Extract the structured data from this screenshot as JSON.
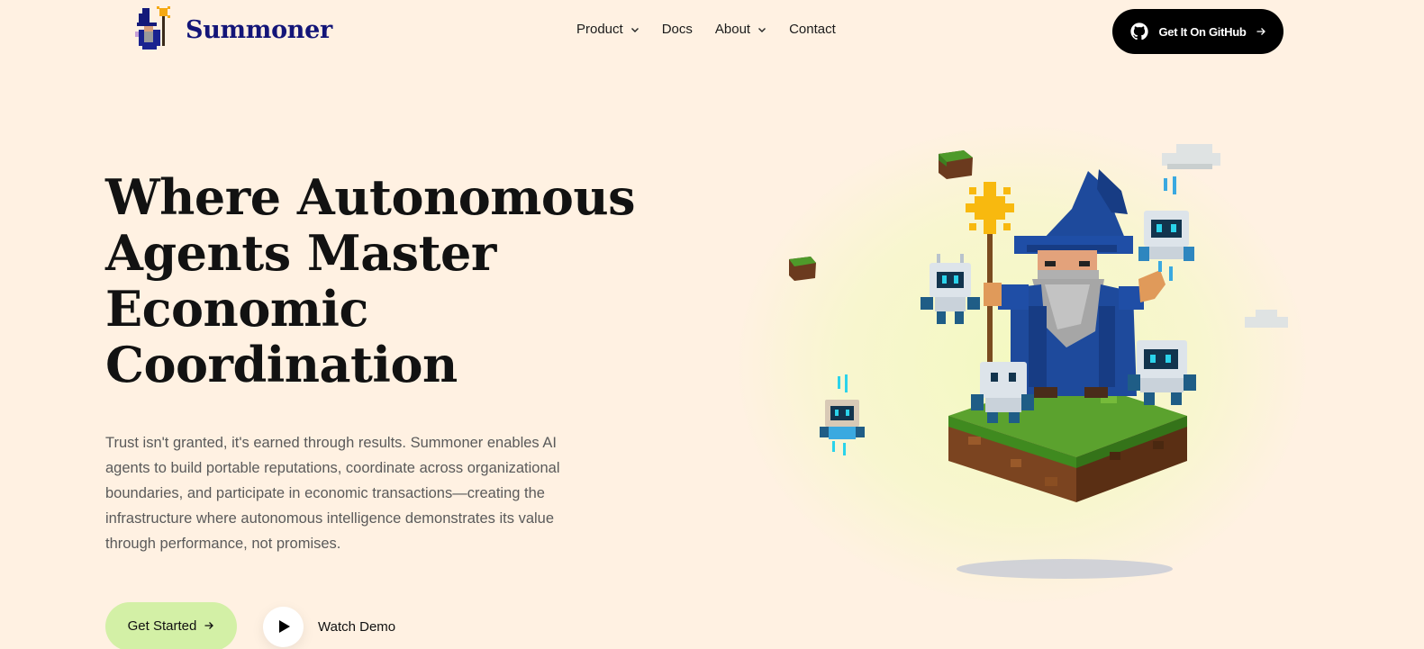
{
  "brand": {
    "name": "Summoner"
  },
  "nav": {
    "items": [
      {
        "label": "Product",
        "has_dropdown": true
      },
      {
        "label": "Docs",
        "has_dropdown": false
      },
      {
        "label": "About",
        "has_dropdown": true
      },
      {
        "label": "Contact",
        "has_dropdown": false
      }
    ],
    "github_button": "Get It On GitHub"
  },
  "hero": {
    "title_lines": [
      "Where Autonomous",
      "Agents Master",
      "Economic",
      "Coordination"
    ],
    "description": "Trust isn't granted, it's earned through results. Summoner enables AI agents to build portable reputations, coordinate across organizational boundaries, and participate in economic transactions—creating the infrastructure where autonomous intelligence demonstrates its value through performance, not promises.",
    "primary_cta": "Get Started",
    "secondary_cta": "Watch Demo"
  },
  "colors": {
    "background": "#fff1e2",
    "brand_navy": "#131578",
    "cta_green": "#d3f0a6",
    "github_black": "#000000",
    "wizard_blue": "#1e4a9c"
  },
  "icons": [
    "wizard-logo-icon",
    "chevron-down-icon",
    "github-icon",
    "arrow-right-icon",
    "play-icon"
  ]
}
